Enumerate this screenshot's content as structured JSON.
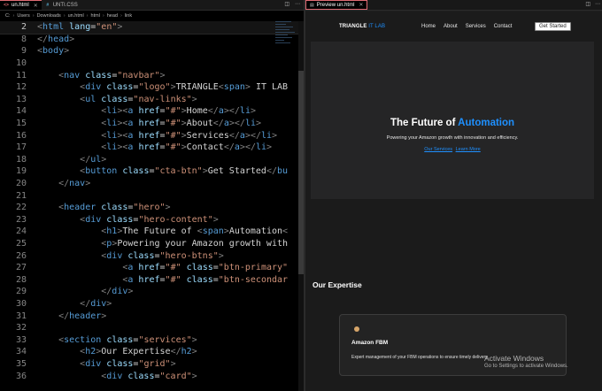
{
  "editor": {
    "tabs": [
      {
        "label": "un.html",
        "icon": "html-file-icon",
        "active": true
      },
      {
        "label": "UNTI.CSS",
        "icon": "css-file-icon",
        "active": false
      }
    ],
    "breadcrumb": [
      "C:",
      "Users",
      "Downloads",
      "un.html",
      "html",
      "head",
      "link"
    ],
    "actions": [
      "split-editor-icon",
      "more-icon"
    ],
    "lines": [
      {
        "n": "2",
        "current": true,
        "code": "<html lang=\"en\">"
      },
      {
        "n": "8",
        "current": false,
        "code": "</head>"
      },
      {
        "n": "9",
        "current": false,
        "code": "<body>"
      },
      {
        "n": "10",
        "current": false,
        "code": ""
      },
      {
        "n": "11",
        "current": false,
        "code": "    <nav class=\"navbar\">"
      },
      {
        "n": "12",
        "current": false,
        "code": "        <div class=\"logo\">TRIANGLE<span> IT LAB"
      },
      {
        "n": "13",
        "current": false,
        "code": "        <ul class=\"nav-links\">"
      },
      {
        "n": "14",
        "current": false,
        "code": "            <li><a href=\"#\">Home</a></li>"
      },
      {
        "n": "15",
        "current": false,
        "code": "            <li><a href=\"#\">About</a></li>"
      },
      {
        "n": "16",
        "current": false,
        "code": "            <li><a href=\"#\">Services</a></li>"
      },
      {
        "n": "17",
        "current": false,
        "code": "            <li><a href=\"#\">Contact</a></li>"
      },
      {
        "n": "18",
        "current": false,
        "code": "        </ul>"
      },
      {
        "n": "19",
        "current": false,
        "code": "        <button class=\"cta-btn\">Get Started</bu"
      },
      {
        "n": "20",
        "current": false,
        "code": "    </nav>"
      },
      {
        "n": "21",
        "current": false,
        "code": ""
      },
      {
        "n": "22",
        "current": false,
        "code": "    <header class=\"hero\">"
      },
      {
        "n": "23",
        "current": false,
        "code": "        <div class=\"hero-content\">"
      },
      {
        "n": "24",
        "current": false,
        "code": "            <h1>The Future of <span>Automation<"
      },
      {
        "n": "25",
        "current": false,
        "code": "            <p>Powering your Amazon growth with"
      },
      {
        "n": "26",
        "current": false,
        "code": "            <div class=\"hero-btns\">"
      },
      {
        "n": "27",
        "current": false,
        "code": "                <a href=\"#\" class=\"btn-primary\""
      },
      {
        "n": "28",
        "current": false,
        "code": "                <a href=\"#\" class=\"btn-secondar"
      },
      {
        "n": "29",
        "current": false,
        "code": "            </div>"
      },
      {
        "n": "30",
        "current": false,
        "code": "        </div>"
      },
      {
        "n": "31",
        "current": false,
        "code": "    </header>"
      },
      {
        "n": "32",
        "current": false,
        "code": ""
      },
      {
        "n": "33",
        "current": false,
        "code": "    <section class=\"services\">"
      },
      {
        "n": "34",
        "current": false,
        "code": "        <h2>Our Expertise</h2>"
      },
      {
        "n": "35",
        "current": false,
        "code": "        <div class=\"grid\">"
      },
      {
        "n": "36",
        "current": false,
        "code": "            <div class=\"card\">"
      }
    ]
  },
  "preview": {
    "tab_label": "Preview un.html",
    "actions": [
      "split-editor-icon",
      "more-icon"
    ],
    "nav": {
      "logo_main": "TRIANGLE",
      "logo_accent": " IT LAB",
      "links": [
        "Home",
        "About",
        "Services",
        "Contact"
      ],
      "cta": "Get Started"
    },
    "hero": {
      "title_main": "The Future of ",
      "title_accent": "Automation",
      "subtitle": "Powering your Amazon growth with innovation and efficiency.",
      "btn_primary": "Our Services",
      "btn_secondary": "Learn More"
    },
    "services": {
      "title": "Our Expertise",
      "card": {
        "title": "Amazon FBM",
        "desc": "Expert management of your FBM operations to ensure timely delivery."
      }
    }
  },
  "watermark": {
    "line1": "Activate Windows",
    "line2": "Go to Settings to activate Windows."
  },
  "colors": {
    "accent": "#1e90ff",
    "tag": "#569cd6",
    "attr": "#9cdcfe",
    "string": "#ce9178",
    "text": "#d4d4d4"
  }
}
